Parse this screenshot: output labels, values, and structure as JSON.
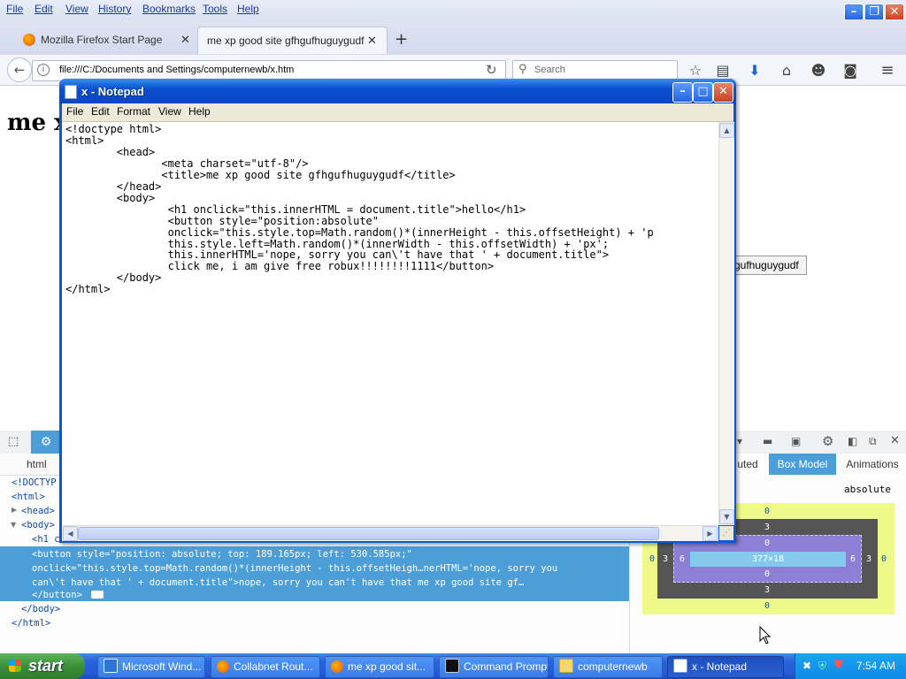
{
  "firefox": {
    "menu": [
      "File",
      "Edit",
      "View",
      "History",
      "Bookmarks",
      "Tools",
      "Help"
    ],
    "tabs": [
      {
        "label": "Mozilla Firefox Start Page"
      },
      {
        "label": "me xp good site gfhgufhuguygudf"
      }
    ],
    "url": "file:///C:/Documents and Settings/computernewb/x.htm",
    "search_placeholder": "Search"
  },
  "page": {
    "h1_visible": "me x",
    "button_visible": "gufhuguygudf"
  },
  "devtools": {
    "breadcrumb": "html",
    "side_tabs": [
      "uted",
      "Box Model",
      "Animations"
    ],
    "position": "absolute",
    "lines": [
      {
        "indent": 0,
        "text": "<!DOCTYP"
      },
      {
        "indent": 0,
        "text": "<html>"
      },
      {
        "indent": 1,
        "text": "<head>"
      },
      {
        "indent": 1,
        "text": "<body>"
      },
      {
        "indent": 2,
        "text": "<h1 c"
      },
      {
        "indent": 2,
        "text": "<button style=\"position: absolute; top: 189.165px; left: 530.585px;\""
      },
      {
        "indent": 2,
        "text": "onclick=\"this.style.top=Math.random()*(innerHeight - this.offsetHeigh…nerHTML='nope, sorry you"
      },
      {
        "indent": 2,
        "text": "can\\'t have that ' + document.title\">nope, sorry you can't have that me xp good site gf…"
      },
      {
        "indent": 2,
        "text": "</button>"
      },
      {
        "indent": 1,
        "text": "</body>"
      },
      {
        "indent": 0,
        "text": "</html>"
      }
    ],
    "box_model": {
      "margin": "0",
      "border": "3",
      "padding": "0",
      "side_left_outer": "0",
      "side_left_border": "3",
      "side_left_padding": "6",
      "content": "377×18",
      "side_right_padding": "6",
      "side_right_border": "3",
      "side_right_outer": "0",
      "padding_bottom": "0",
      "border_bottom": "3",
      "margin_bottom": "0"
    }
  },
  "notepad": {
    "title": "x - Notepad",
    "menu": [
      "File",
      "Edit",
      "Format",
      "View",
      "Help"
    ],
    "code": "<!doctype html>\n<html>\n        <head>\n               <meta charset=\"utf-8\"/>\n               <title>me xp good site gfhgufhuguygudf</title>\n        </head>\n        <body>\n                <h1 onclick=\"this.innerHTML = document.title\">hello</h1>\n                <button style=\"position:absolute\"\n                onclick=\"this.style.top=Math.random()*(innerHeight - this.offsetHeight) + 'p\n                this.style.left=Math.random()*(innerWidth - this.offsetWidth) + 'px';\n                this.innerHTML='nope, sorry you can\\'t have that ' + document.title\">\n                click me, i am give free robux!!!!!!!!1111</button>\n        </body>\n</html>"
  },
  "taskbar": {
    "start": "start",
    "tasks": [
      {
        "label": "Microsoft Wind..."
      },
      {
        "label": "Collabnet Rout..."
      },
      {
        "label": "me xp good sit..."
      },
      {
        "label": "Command Prompt"
      },
      {
        "label": "computernewb"
      },
      {
        "label": "x - Notepad"
      }
    ],
    "clock": "7:54 AM"
  }
}
